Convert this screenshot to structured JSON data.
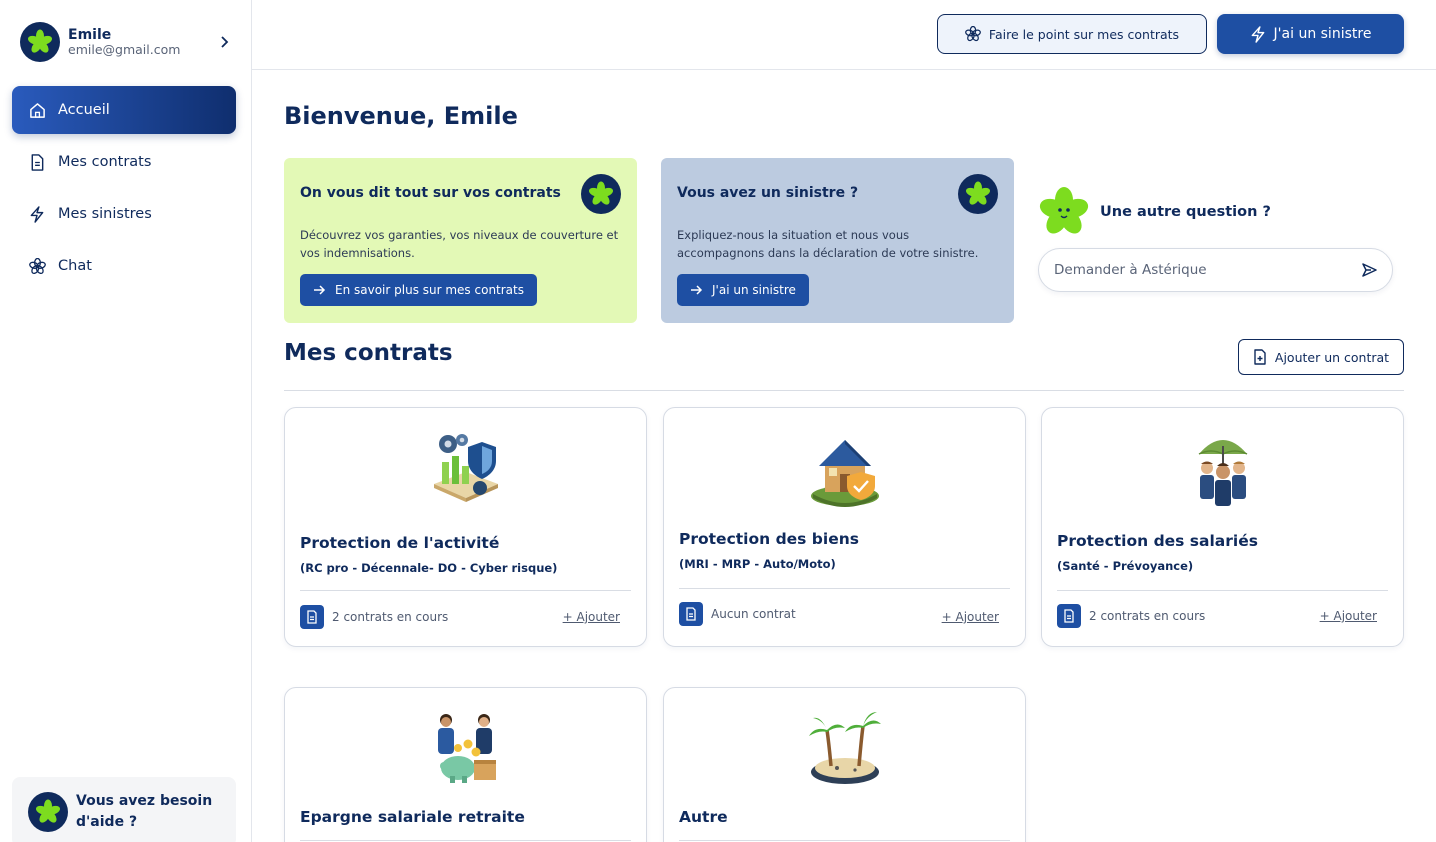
{
  "sidebar": {
    "profile": {
      "name": "Emile",
      "email": "emile@gmail.com"
    },
    "items": [
      {
        "label": "Accueil",
        "icon": "home-icon",
        "active": true
      },
      {
        "label": "Mes contrats",
        "icon": "document-icon"
      },
      {
        "label": "Mes sinistres",
        "icon": "lightning-icon"
      },
      {
        "label": "Chat",
        "icon": "chat-flower-icon"
      }
    ],
    "help": "Vous avez besoin d'aide ?"
  },
  "topbar": {
    "review_label": "Faire le point sur mes contrats",
    "claim_label": "J'ai un sinistre"
  },
  "main": {
    "welcome": "Bienvenue, Emile",
    "promos": [
      {
        "title": "On vous dit tout sur vos contrats",
        "desc": "Découvrez vos garanties, vos niveaux de couverture et vos indemnisations.",
        "button": "En savoir plus sur mes contrats"
      },
      {
        "title": "Vous avez un sinistre ?",
        "desc": "Expliquez-nous la situation et nous vous accompagnons dans la déclaration de votre sinistre.",
        "button": "J'ai un sinistre"
      }
    ],
    "question": {
      "title": "Une autre question ?",
      "placeholder": "Demander à Astérique"
    },
    "contracts_title": "Mes contrats",
    "add_contract_label": "Ajouter un contrat",
    "cards": [
      {
        "title": "Protection de l'activité",
        "subtitle": "(RC pro - Décennale- DO - Cyber risque)",
        "count": "2 contrats en cours",
        "add": "+ Ajouter",
        "icon": "gears-shield-icon"
      },
      {
        "title": "Protection des biens",
        "subtitle": "(MRI - MRP - Auto/Moto)",
        "count": "Aucun contrat",
        "add": "+ Ajouter",
        "icon": "house-shield-icon"
      },
      {
        "title": "Protection des salariés",
        "subtitle": "(Santé - Prévoyance)",
        "count": "2 contrats en cours",
        "add": "+ Ajouter",
        "icon": "people-umbrella-icon"
      },
      {
        "title": "Epargne salariale retraite",
        "icon": "piggy-bank-icon"
      },
      {
        "title": "Autre",
        "icon": "palm-island-icon"
      }
    ]
  },
  "colors": {
    "primary": "#1e4fa3",
    "navy": "#0f2a5c",
    "lime": "#7ddc1f",
    "green_card": "#e3f9b6",
    "blue_card": "#bccbe0"
  }
}
